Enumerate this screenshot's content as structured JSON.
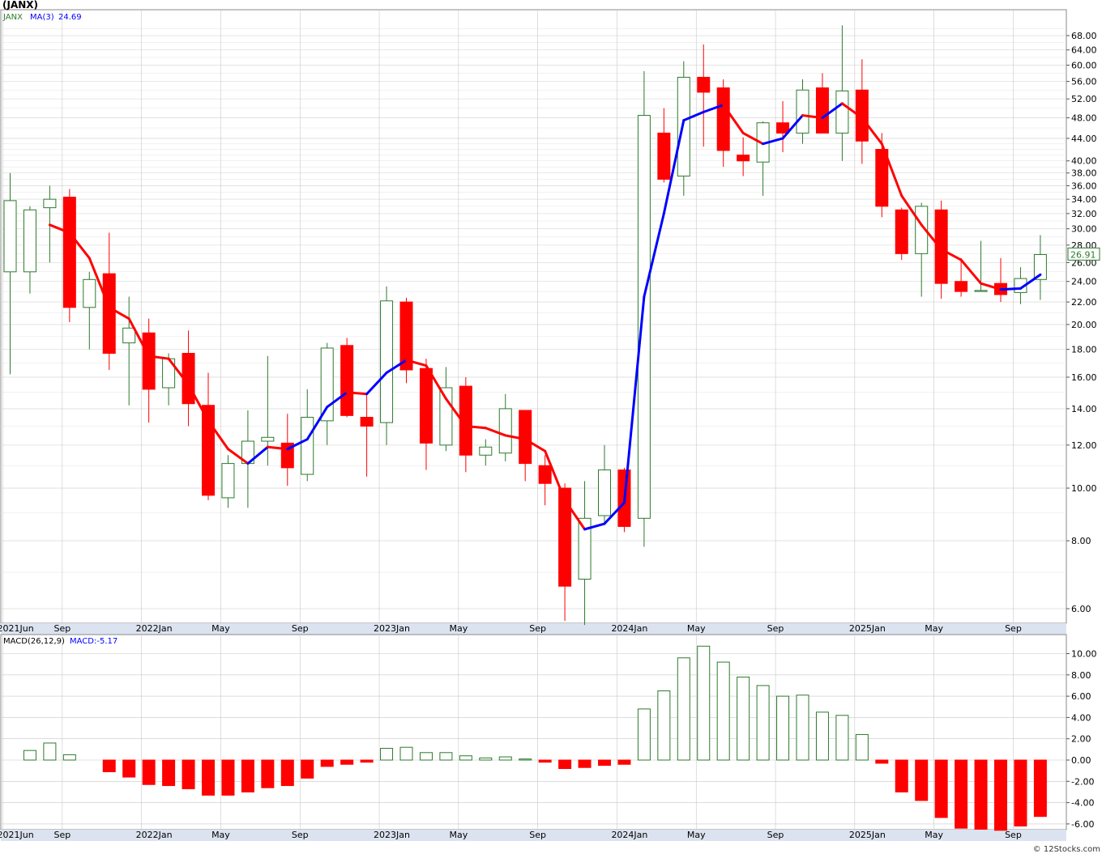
{
  "header": {
    "symbol": "(JANX)",
    "legend_symbol": "JANX",
    "ma_label": "MA(3)",
    "ma_value": "24.69",
    "last_price": "26.91"
  },
  "macd": {
    "label": "MACD(26,12,9)",
    "value_label": "MACD:-5.17"
  },
  "footer": {
    "credit": "© 12Stocks.com"
  },
  "colors": {
    "up": "#2d7a2d",
    "down": "#ff0000",
    "ma_up": "#0000ff",
    "ma_down": "#ff0000",
    "axis_band": "#dce3f0",
    "grid": "#c8c8c8"
  },
  "chart_data": {
    "type": "candlestick",
    "price_scale": "log",
    "price_ticks": [
      "6.00",
      "8.00",
      "10.00",
      "12.00",
      "14.00",
      "16.00",
      "18.00",
      "20.00",
      "22.00",
      "24.00",
      "26.00",
      "28.00",
      "30.00",
      "32.00",
      "34.00",
      "36.00",
      "38.00",
      "40.00",
      "44.00",
      "48.00",
      "52.00",
      "56.00",
      "60.00",
      "64.00",
      "68.00"
    ],
    "macd_ticks": [
      "-6.00",
      "-4.00",
      "-2.00",
      "0.00",
      "2.00",
      "4.00",
      "6.00",
      "8.00",
      "10.00"
    ],
    "macd_range": [
      -6.6,
      10.6
    ],
    "x_labels": [
      {
        "i": 0,
        "text": "2021Jun"
      },
      {
        "i": 3,
        "text": "Sep"
      },
      {
        "i": 7,
        "text": "2022Jan"
      },
      {
        "i": 11,
        "text": "May"
      },
      {
        "i": 15,
        "text": "Sep"
      },
      {
        "i": 19,
        "text": "2023Jan"
      },
      {
        "i": 23,
        "text": "May"
      },
      {
        "i": 27,
        "text": "Sep"
      },
      {
        "i": 31,
        "text": "2024Jan"
      },
      {
        "i": 35,
        "text": "May"
      },
      {
        "i": 39,
        "text": "Sep"
      },
      {
        "i": 43,
        "text": "2025Jan"
      },
      {
        "i": 47,
        "text": "May"
      },
      {
        "i": 51,
        "text": "Sep"
      }
    ],
    "candles": [
      {
        "o": 25.0,
        "h": 38.0,
        "l": 16.2,
        "c": 33.8
      },
      {
        "o": 25.0,
        "h": 33.0,
        "l": 22.8,
        "c": 32.5
      },
      {
        "o": 32.8,
        "h": 36.0,
        "l": 26.0,
        "c": 34.0
      },
      {
        "o": 34.3,
        "h": 35.5,
        "l": 20.2,
        "c": 21.5
      },
      {
        "o": 21.5,
        "h": 25.0,
        "l": 18.0,
        "c": 24.2
      },
      {
        "o": 24.8,
        "h": 29.5,
        "l": 16.5,
        "c": 17.7
      },
      {
        "o": 18.5,
        "h": 22.5,
        "l": 14.2,
        "c": 19.7
      },
      {
        "o": 19.3,
        "h": 20.5,
        "l": 13.2,
        "c": 15.2
      },
      {
        "o": 15.3,
        "h": 17.7,
        "l": 14.2,
        "c": 17.3
      },
      {
        "o": 17.7,
        "h": 19.5,
        "l": 13.0,
        "c": 14.3
      },
      {
        "o": 14.2,
        "h": 16.3,
        "l": 9.5,
        "c": 9.7
      },
      {
        "o": 9.6,
        "h": 11.5,
        "l": 9.2,
        "c": 11.1
      },
      {
        "o": 11.1,
        "h": 13.9,
        "l": 9.2,
        "c": 12.2
      },
      {
        "o": 12.2,
        "h": 17.5,
        "l": 11.0,
        "c": 12.4
      },
      {
        "o": 12.1,
        "h": 13.7,
        "l": 10.1,
        "c": 10.9
      },
      {
        "o": 10.6,
        "h": 15.2,
        "l": 10.3,
        "c": 13.5
      },
      {
        "o": 13.3,
        "h": 18.5,
        "l": 12.0,
        "c": 18.1
      },
      {
        "o": 18.3,
        "h": 18.9,
        "l": 13.5,
        "c": 13.6
      },
      {
        "o": 13.5,
        "h": 15.0,
        "l": 10.5,
        "c": 13.0
      },
      {
        "o": 13.2,
        "h": 23.5,
        "l": 12.0,
        "c": 22.1
      },
      {
        "o": 22.0,
        "h": 22.4,
        "l": 15.6,
        "c": 16.5
      },
      {
        "o": 16.6,
        "h": 17.3,
        "l": 10.8,
        "c": 12.1
      },
      {
        "o": 12.0,
        "h": 16.7,
        "l": 11.7,
        "c": 15.3
      },
      {
        "o": 15.4,
        "h": 16.0,
        "l": 10.7,
        "c": 11.5
      },
      {
        "o": 11.5,
        "h": 12.3,
        "l": 11.0,
        "c": 11.9
      },
      {
        "o": 11.6,
        "h": 14.9,
        "l": 11.2,
        "c": 14.0
      },
      {
        "o": 13.9,
        "h": 13.9,
        "l": 10.3,
        "c": 11.1
      },
      {
        "o": 11.0,
        "h": 11.5,
        "l": 9.3,
        "c": 10.2
      },
      {
        "o": 10.0,
        "h": 10.2,
        "l": 5.7,
        "c": 6.6
      },
      {
        "o": 6.8,
        "h": 10.3,
        "l": 5.6,
        "c": 8.8
      },
      {
        "o": 8.9,
        "h": 12.0,
        "l": 8.6,
        "c": 10.8
      },
      {
        "o": 10.8,
        "h": 10.9,
        "l": 8.3,
        "c": 8.5
      },
      {
        "o": 8.8,
        "h": 58.5,
        "l": 7.8,
        "c": 48.5
      },
      {
        "o": 45.0,
        "h": 50.0,
        "l": 36.5,
        "c": 37.0
      },
      {
        "o": 37.5,
        "h": 61.0,
        "l": 34.5,
        "c": 57.0
      },
      {
        "o": 57.0,
        "h": 65.5,
        "l": 42.5,
        "c": 53.5
      },
      {
        "o": 54.5,
        "h": 56.5,
        "l": 39.0,
        "c": 41.8
      },
      {
        "o": 41.0,
        "h": 44.2,
        "l": 37.5,
        "c": 40.0
      },
      {
        "o": 39.8,
        "h": 47.3,
        "l": 34.5,
        "c": 47.0
      },
      {
        "o": 47.0,
        "h": 51.5,
        "l": 41.5,
        "c": 45.0
      },
      {
        "o": 45.0,
        "h": 56.5,
        "l": 43.0,
        "c": 54.0
      },
      {
        "o": 54.5,
        "h": 58.0,
        "l": 45.0,
        "c": 45.0
      },
      {
        "o": 45.0,
        "h": 71.0,
        "l": 40.0,
        "c": 53.8
      },
      {
        "o": 54.0,
        "h": 61.5,
        "l": 39.5,
        "c": 43.5
      },
      {
        "o": 42.0,
        "h": 45.0,
        "l": 31.5,
        "c": 33.0
      },
      {
        "o": 32.5,
        "h": 32.8,
        "l": 26.3,
        "c": 27.0
      },
      {
        "o": 27.0,
        "h": 33.5,
        "l": 22.5,
        "c": 33.0
      },
      {
        "o": 32.5,
        "h": 33.8,
        "l": 22.3,
        "c": 23.8
      },
      {
        "o": 24.0,
        "h": 26.5,
        "l": 22.5,
        "c": 23.0
      },
      {
        "o": 23.0,
        "h": 28.5,
        "l": 23.0,
        "c": 23.1
      },
      {
        "o": 23.8,
        "h": 26.5,
        "l": 22.0,
        "c": 22.7
      },
      {
        "o": 22.9,
        "h": 25.5,
        "l": 21.8,
        "c": 24.3
      },
      {
        "o": 24.2,
        "h": 29.2,
        "l": 22.2,
        "c": 26.9
      }
    ],
    "ma": [
      null,
      null,
      30.5,
      29.5,
      26.5,
      21.5,
      20.5,
      17.5,
      17.3,
      15.5,
      13.3,
      11.8,
      11.1,
      11.9,
      11.8,
      12.3,
      14.1,
      15.0,
      14.9,
      16.3,
      17.2,
      16.8,
      14.6,
      13.0,
      12.9,
      12.5,
      12.3,
      11.7,
      9.5,
      8.4,
      8.6,
      9.4,
      22.5,
      32.0,
      47.5,
      49.2,
      50.7,
      45.0,
      43.0,
      44.0,
      48.5,
      48.0,
      51.0,
      48.0,
      43.0,
      34.5,
      30.5,
      27.5,
      26.3,
      23.8,
      23.2,
      23.3,
      24.7
    ],
    "macd_hist": [
      0,
      0.9,
      1.6,
      0.5,
      0.0,
      -1.1,
      -1.6,
      -2.3,
      -2.4,
      -2.7,
      -3.3,
      -3.3,
      -3.0,
      -2.6,
      -2.4,
      -1.7,
      -0.6,
      -0.4,
      -0.2,
      1.1,
      1.2,
      0.7,
      0.7,
      0.4,
      0.2,
      0.3,
      0.1,
      -0.2,
      -0.8,
      -0.7,
      -0.5,
      -0.4,
      4.8,
      6.5,
      9.6,
      10.7,
      9.2,
      7.8,
      7.0,
      6.0,
      6.1,
      4.5,
      4.2,
      2.4,
      -0.3,
      -3.0,
      -3.8,
      -5.4,
      -6.4,
      -6.5,
      -6.6,
      -6.2,
      -5.3
    ]
  }
}
